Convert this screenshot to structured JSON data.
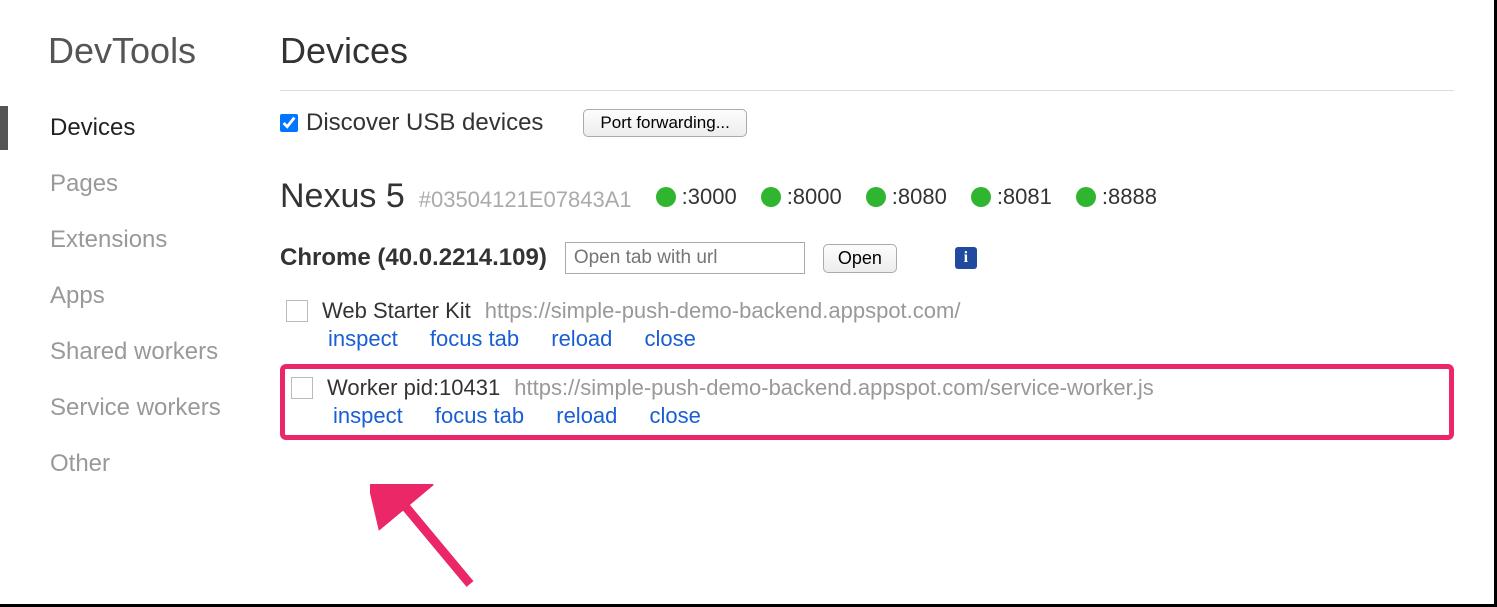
{
  "sidebar": {
    "title": "DevTools",
    "items": [
      {
        "label": "Devices",
        "active": true
      },
      {
        "label": "Pages",
        "active": false
      },
      {
        "label": "Extensions",
        "active": false
      },
      {
        "label": "Apps",
        "active": false
      },
      {
        "label": "Shared workers",
        "active": false
      },
      {
        "label": "Service workers",
        "active": false
      },
      {
        "label": "Other",
        "active": false
      }
    ]
  },
  "page": {
    "title": "Devices",
    "discover_label": "Discover USB devices",
    "discover_checked": true,
    "port_forwarding_label": "Port forwarding..."
  },
  "device": {
    "name": "Nexus 5",
    "serial": "#03504121E07843A1",
    "ports": [
      ":3000",
      ":8000",
      ":8080",
      ":8081",
      ":8888"
    ]
  },
  "browser": {
    "label": "Chrome (40.0.2214.109)",
    "url_placeholder": "Open tab with url",
    "open_label": "Open"
  },
  "entries": [
    {
      "title": "Web Starter Kit",
      "url": "https://simple-push-demo-backend.appspot.com/",
      "highlight": false
    },
    {
      "title": "Worker pid:10431",
      "url": "https://simple-push-demo-backend.appspot.com/service-worker.js",
      "highlight": true
    }
  ],
  "actions": {
    "inspect": "inspect",
    "focus_tab": "focus tab",
    "reload": "reload",
    "close": "close"
  }
}
